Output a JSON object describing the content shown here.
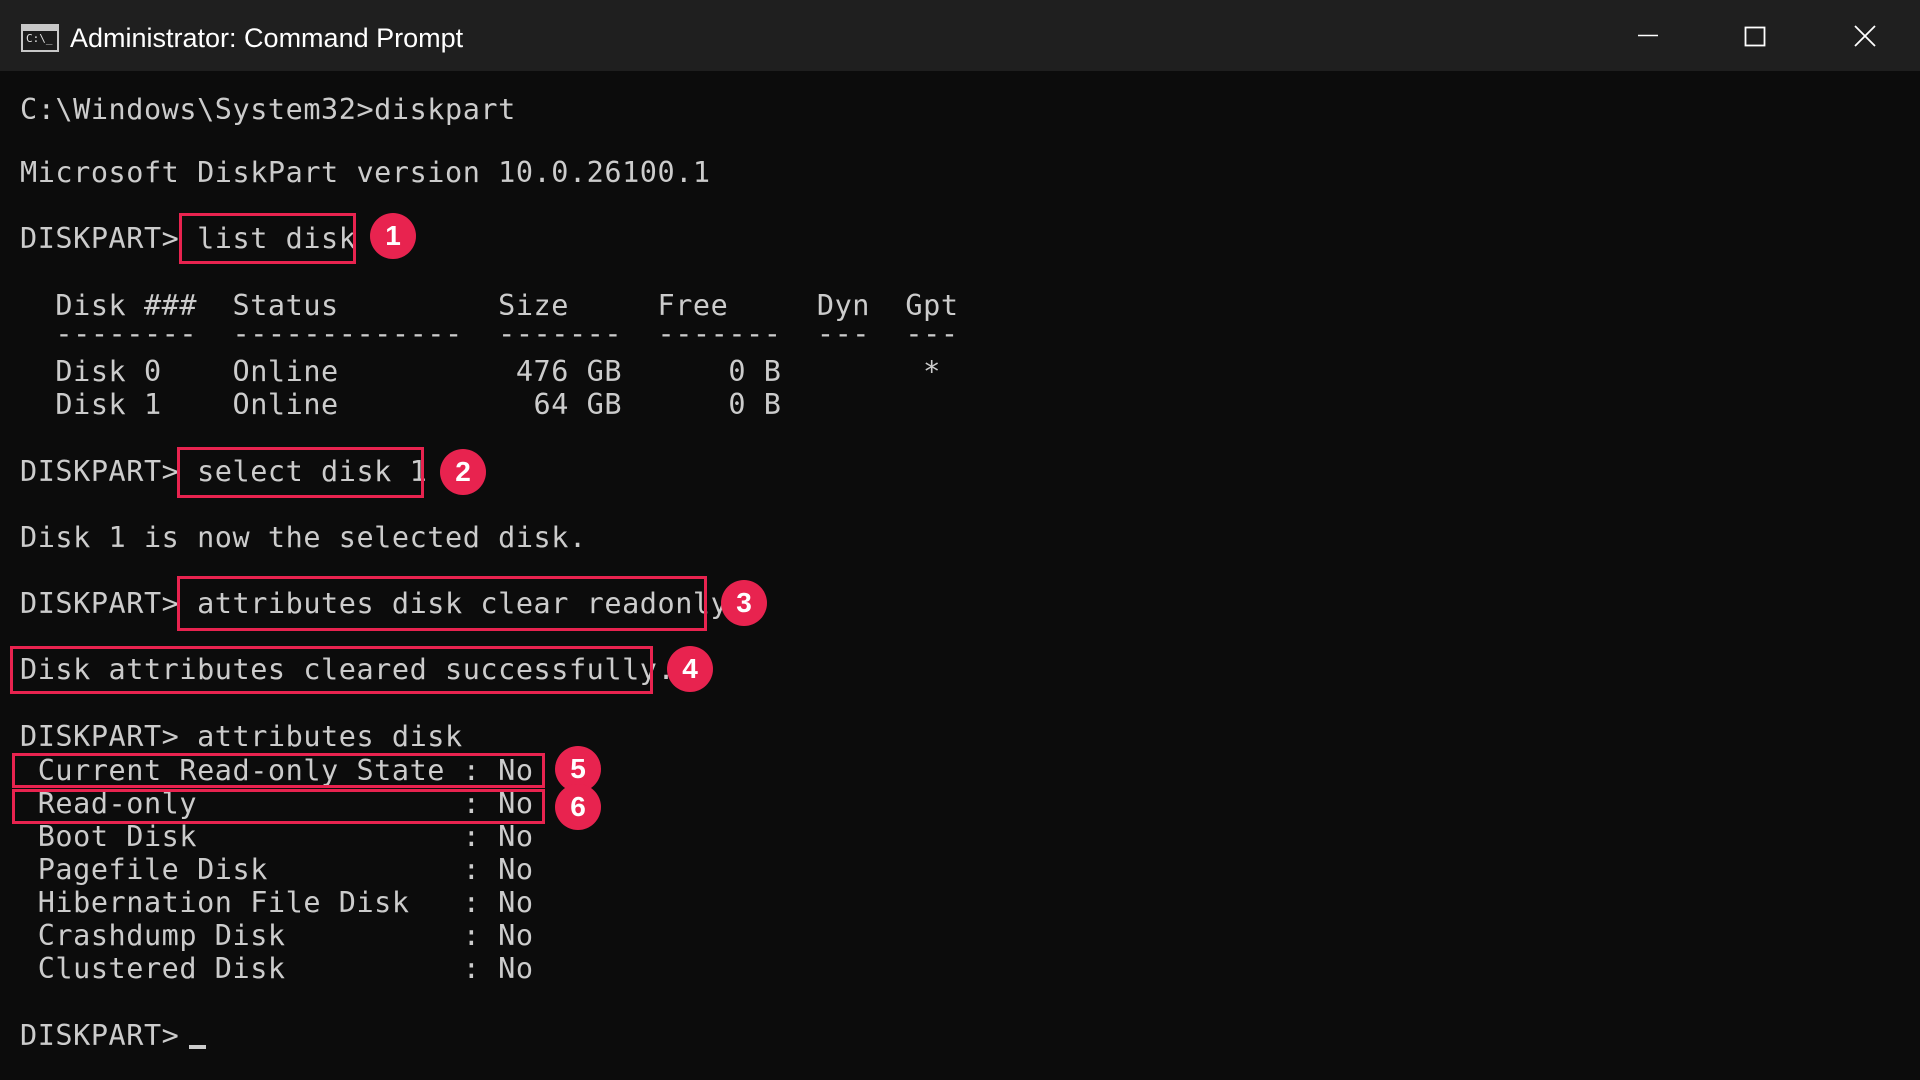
{
  "window": {
    "title": "Administrator: Command Prompt",
    "app_icon_text": "C:\\_",
    "controls": [
      "minimize",
      "maximize",
      "close"
    ]
  },
  "console": {
    "lines": [
      "C:\\Windows\\System32>diskpart",
      "Microsoft DiskPart version 10.0.26100.1",
      "DISKPART> list disk",
      "  Disk ###  Status         Size     Free     Dyn  Gpt",
      "  --------  -------------  -------  -------  ---  ---",
      "  Disk 0    Online          476 GB      0 B        *",
      "  Disk 1    Online           64 GB      0 B",
      "DISKPART> select disk 1",
      "Disk 1 is now the selected disk.",
      "DISKPART> attributes disk clear readonly",
      "Disk attributes cleared successfully.",
      "DISKPART> attributes disk",
      " Current Read-only State : No",
      " Read-only               : No",
      " Boot Disk               : No",
      " Pagefile Disk           : No",
      " Hibernation File Disk   : No",
      " Crashdump Disk          : No",
      " Clustered Disk          : No",
      "DISKPART> "
    ]
  },
  "annotations": [
    "1",
    "2",
    "3",
    "4",
    "5",
    "6"
  ],
  "colors": {
    "background": "#0c0c0c",
    "titlebar": "#1f1f1f",
    "text": "#cccccc",
    "highlight": "#e8234f"
  }
}
